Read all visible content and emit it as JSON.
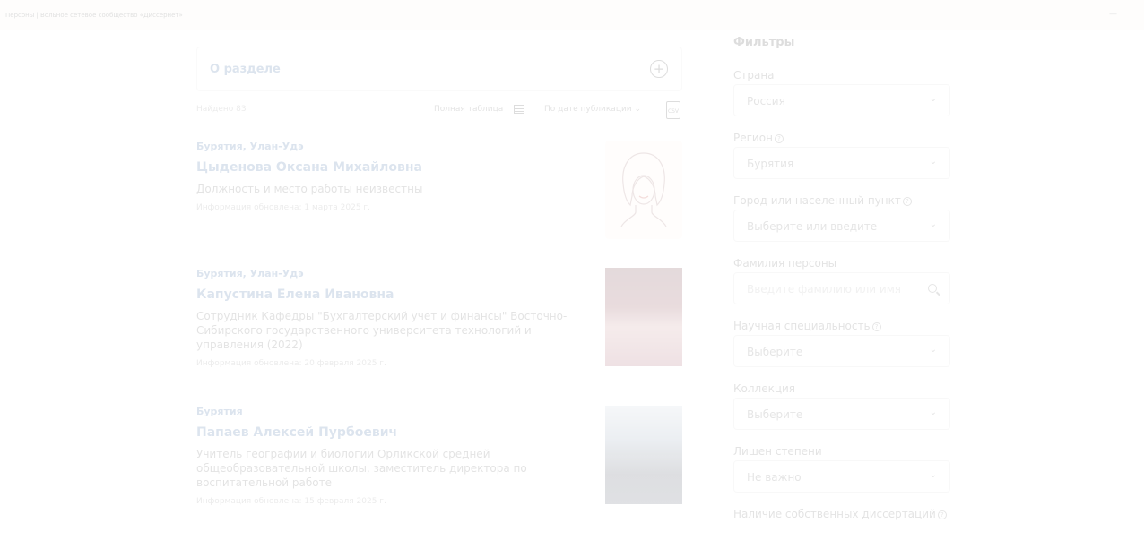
{
  "window": {
    "title": "Персоны | Вольное сетевое сообщество «Диссернет»",
    "control": "—"
  },
  "about": {
    "label": "О разделе",
    "plus": "+"
  },
  "toolbar": {
    "found": "Найдено 83",
    "full_table": "Полная таблица",
    "sort": "По дате публикации ⌄",
    "csv": "CSV"
  },
  "persons": [
    {
      "region": "Бурятия, Улан-Удэ",
      "name": "Цыденова Оксана Михайловна",
      "position": "Должность и место работы неизвестны",
      "updated": "Информация обновлена: 1 марта 2025 г."
    },
    {
      "region": "Бурятия, Улан-Удэ",
      "name": "Капустина Елена Ивановна",
      "position": "Сотрудник Кафедры \"Бухгалтерский учет и финансы\" Восточно-Сибирского государственного университета технологий и управления (2022)",
      "updated": "Информация обновлена: 20 февраля 2025 г."
    },
    {
      "region": "Бурятия",
      "name": "Папаев Алексей Пурбоевич",
      "position": "Учитель географии и биологии Орликской средней общеобразовательной школы, заместитель директора по воспитательной работе",
      "updated": "Информация обновлена: 15 февраля 2025 г."
    }
  ],
  "filters": {
    "title": "Фильтры",
    "country": {
      "label": "Страна",
      "value": "Россия"
    },
    "region": {
      "label": "Регион",
      "value": "Бурятия"
    },
    "city": {
      "label": "Город или населенный пункт",
      "value": "Выберите или введите"
    },
    "surname": {
      "label": "Фамилия персоны",
      "placeholder": "Введите фамилию или имя"
    },
    "specialty": {
      "label": "Научная специальность",
      "value": "Выберите"
    },
    "collection": {
      "label": "Коллекция",
      "value": "Выберите"
    },
    "degree": {
      "label": "Лишен степени",
      "value": "Не важно"
    },
    "own_diss": {
      "label": "Наличие собственных диссертаций"
    }
  },
  "icons": {
    "help": "?",
    "chevron": "⌄"
  }
}
